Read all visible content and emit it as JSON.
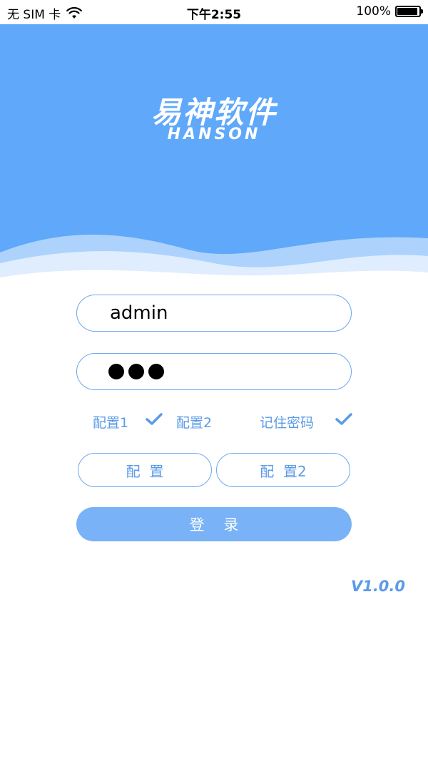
{
  "status_bar": {
    "carrier": "无 SIM 卡",
    "time": "下午2:55",
    "battery": "100%",
    "battery_level": 1.0
  },
  "logo": {
    "cn": "易神软件",
    "en": "HANSON"
  },
  "form": {
    "username_value": "admin",
    "password_dot_count": 3
  },
  "options": {
    "config1_label": "配置1",
    "config1_checked": true,
    "config2_label": "配置2",
    "config2_checked": false,
    "remember_label": "记住密码",
    "remember_checked": true
  },
  "buttons": {
    "config_label": "配  置",
    "config2_label": "配  置2",
    "login_label": "登    录"
  },
  "version": "V1.0.0",
  "colors": {
    "header_blue": "#5fa8fa",
    "accent": "#5b9be8",
    "login_button": "#79b2f6"
  }
}
